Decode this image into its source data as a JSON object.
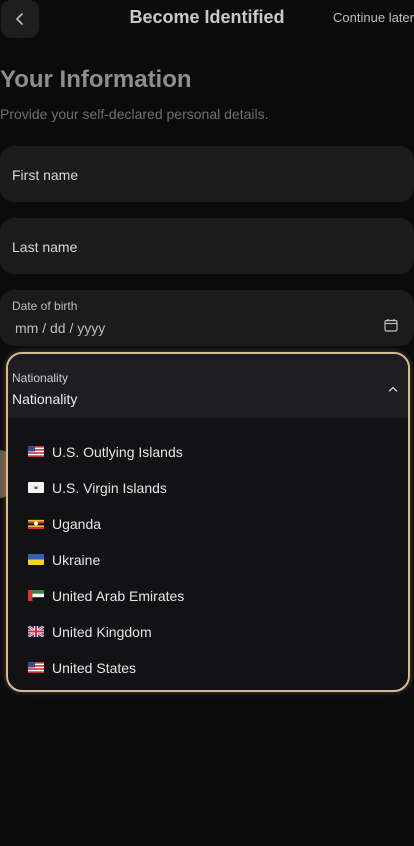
{
  "header": {
    "title": "Become Identified",
    "continue_label": "Continue later"
  },
  "intro": {
    "title": "Your Information",
    "subtitle": "Provide your self-declared personal details."
  },
  "form": {
    "first_name_placeholder": "First name",
    "last_name_placeholder": "Last name",
    "dob_label": "Date of birth",
    "dob_value": "mm / dd / yyyy",
    "nationality_label": "Nationality",
    "nationality_value": "Nationality"
  },
  "nationality_options": [
    {
      "label": "U.S. Outlying Islands",
      "flag": "us-flag-icon"
    },
    {
      "label": "U.S. Virgin Islands",
      "flag": "usvi-flag-icon"
    },
    {
      "label": "Uganda",
      "flag": "uganda-flag-icon"
    },
    {
      "label": "Ukraine",
      "flag": "ukraine-flag-icon"
    },
    {
      "label": "United Arab Emirates",
      "flag": "uae-flag-icon"
    },
    {
      "label": "United Kingdom",
      "flag": "uk-flag-icon"
    },
    {
      "label": "United States",
      "flag": "us-flag-icon"
    }
  ],
  "colors": {
    "background": "#0b0b0b",
    "field_background": "#1b1b1c",
    "accent_border": "#d9b894"
  }
}
